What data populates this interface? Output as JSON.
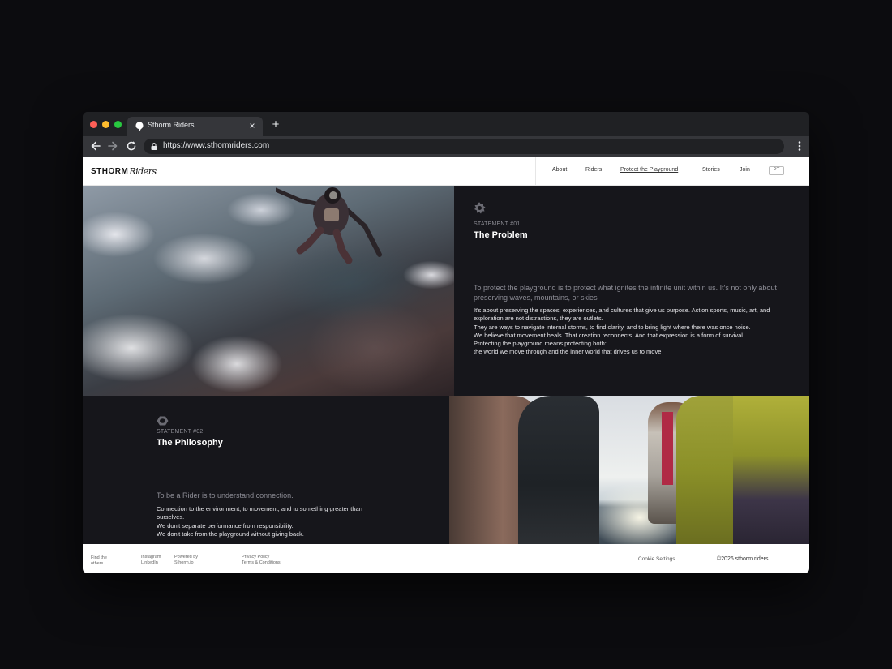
{
  "browser": {
    "tab_title": "Sthorm Riders",
    "url": "https://www.sthormriders.com"
  },
  "header": {
    "logo_main": "STHORM",
    "logo_script": "Riders",
    "nav": [
      "About",
      "Riders",
      "Protect the Playground",
      "Stories",
      "Join"
    ],
    "active_nav": "Protect the Playground",
    "lang": "PT"
  },
  "statement1": {
    "kicker": "STATEMENT #01",
    "title": "The Problem",
    "lead": "To protect the playground is to protect what ignites the infinite unit within us. It's not only about preserving waves, mountains, or skies",
    "body": "It's about preserving the spaces, experiences, and cultures that give us purpose. Action sports, music, art, and exploration are not distractions, they are outlets.\nThey are ways to navigate internal storms, to find clarity, and to bring light where there was once noise.\nWe believe that movement heals. That creation reconnects. And that expression is a form of survival.\nProtecting the playground means protecting both:\nthe world we move through and the inner world that drives us to move"
  },
  "statement2": {
    "kicker": "STATEMENT #02",
    "title": "The Philosophy",
    "lead": "To be a Rider is to understand connection.",
    "body": "Connection to the environment, to movement, and to something greater than ourselves.\nWe don't separate performance from responsibility.\nWe don't take from the playground without giving back."
  },
  "footer": {
    "find": "Find the others",
    "social": "Instagram\nLinkedIn",
    "powered": "Powered by\nSthorm.io",
    "legal": "Privacy Policy\nTerms & Conditions",
    "cookie": "Cookie Settings",
    "copyright": "©2026 sthorm riders"
  },
  "icons": [
    "favicon-icon",
    "close-icon",
    "plus-icon",
    "back-arrow-icon",
    "forward-arrow-icon",
    "reload-icon",
    "lock-icon",
    "menu-dots-icon",
    "gear-badge-icon",
    "ring-badge-icon"
  ]
}
